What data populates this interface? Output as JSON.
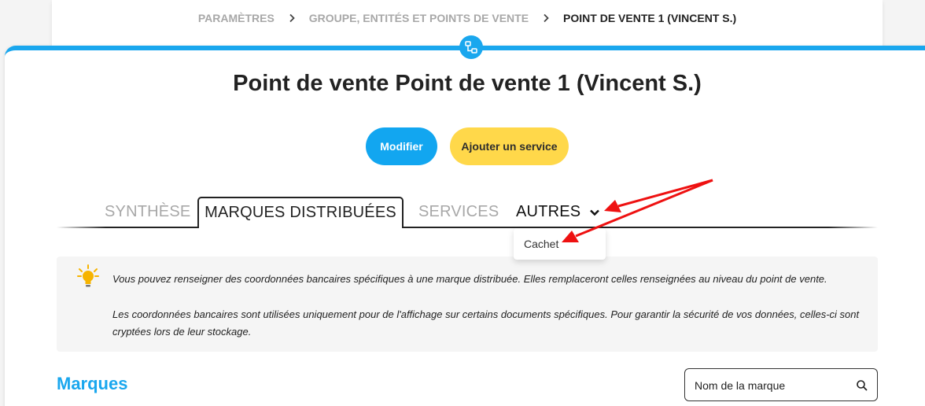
{
  "breadcrumb": {
    "items": [
      "PARAMÈTRES",
      "GROUPE, ENTITÉS ET POINTS DE VENTE"
    ],
    "current": "POINT DE VENTE 1 (VINCENT S.)"
  },
  "page": {
    "title": "Point de vente Point de vente 1 (Vincent S.)"
  },
  "actions": {
    "modifier": "Modifier",
    "ajouter_service": "Ajouter un service"
  },
  "tabs": [
    {
      "label": "SYNTHÈSE",
      "active": false
    },
    {
      "label": "MARQUES DISTRIBUÉES",
      "active": true
    },
    {
      "label": "SERVICES",
      "active": false
    },
    {
      "label": "AUTRES",
      "active": false
    }
  ],
  "dropdown": {
    "items": [
      "Cachet"
    ]
  },
  "info": {
    "line1": "Vous pouvez renseigner des coordonnées bancaires spécifiques à une marque distribuée. Elles remplaceront celles renseignées au niveau du point de vente.",
    "line2": "Les coordonnées bancaires sont utilisées uniquement pour de l'affichage sur certains documents spécifiques. Pour garantir la sécurité de vos données, celles-ci sont cryptées lors de leur stockage."
  },
  "section": {
    "title": "Marques"
  },
  "search": {
    "placeholder": "Nom de la marque",
    "value": ""
  },
  "colors": {
    "accent": "#1aa7ee",
    "primary_button": "#12a6f0",
    "secondary_button": "#ffd84a",
    "annotation_arrow": "#ee1111"
  },
  "icons": [
    "network-icon",
    "chevron-right-icon",
    "chevron-down-icon",
    "lightbulb-icon",
    "search-icon"
  ]
}
